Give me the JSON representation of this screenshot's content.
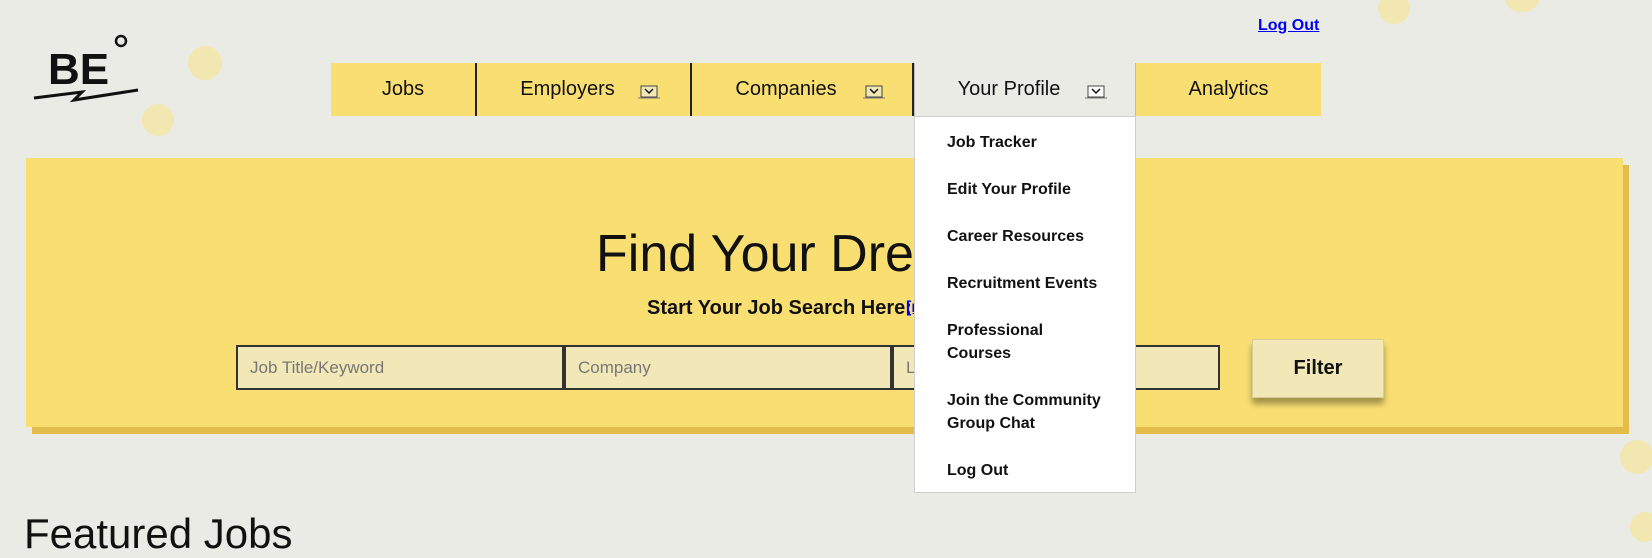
{
  "header": {
    "logo_text": "BE",
    "logo_mark": "c",
    "logout_link": "Log Out"
  },
  "nav": {
    "items": [
      {
        "label": "Jobs",
        "has_dropdown": false
      },
      {
        "label": "Employers",
        "has_dropdown": true
      },
      {
        "label": "Companies",
        "has_dropdown": true
      },
      {
        "label": "Your Profile",
        "has_dropdown": true,
        "active": true
      },
      {
        "label": "Analytics",
        "has_dropdown": false
      }
    ],
    "dropdown_icon": "chevron-down-icon"
  },
  "profile_menu": {
    "items": [
      {
        "label": "Job Tracker"
      },
      {
        "label": "Edit Your Profile"
      },
      {
        "label": "Career Resources"
      },
      {
        "label": "Recruitment Events"
      },
      {
        "label": "Professional Courses"
      },
      {
        "label": "Join the Community Group Chat"
      },
      {
        "label": "Log Out"
      }
    ]
  },
  "hero": {
    "title": "Find Your Dream Job",
    "subtitle": "Start Your Job Search Here:",
    "link_text": "[n",
    "search": {
      "keyword_placeholder": "Job Title/Keyword",
      "company_placeholder": "Company",
      "location_placeholder": "Location"
    },
    "filter_button": "Filter"
  },
  "featured": {
    "title": "Featured Jobs"
  },
  "colors": {
    "background": "#ebebe6",
    "accent_yellow": "#f9df72",
    "hero_shadow": "#e3bc4b",
    "input_fill": "#f2e7b7",
    "link_blue": "#0000ee"
  }
}
